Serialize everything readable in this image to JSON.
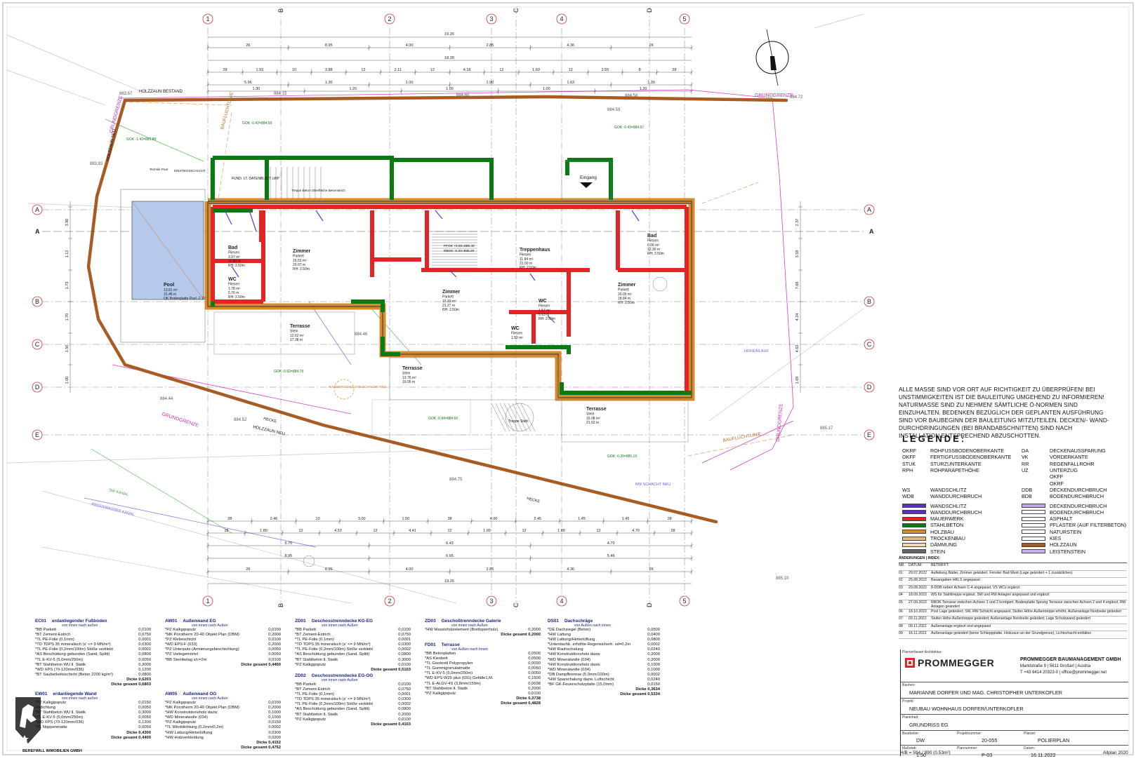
{
  "axes": {
    "numbers": [
      "1",
      "2",
      "3",
      "4",
      "5"
    ],
    "letters_top": [
      "B",
      "C",
      "D"
    ],
    "letters_side": [
      "A",
      "B",
      "C",
      "D",
      "E"
    ],
    "section": "A"
  },
  "dims": {
    "top_total": "19.26",
    "top_row1": [
      "26",
      "8.95",
      "4.00",
      "2.85",
      "4.36",
      "26"
    ],
    "top_row2": "18.30",
    "top_row3": [
      "28",
      "1.93",
      "10",
      "3.88",
      "12",
      "2.11",
      "12",
      "4.18",
      "12",
      "1.60",
      "12",
      "2.55",
      "8",
      "28"
    ],
    "top_row4": [
      "5.96",
      "1.30",
      "1.00",
      "1.90",
      "1.63",
      "1.30"
    ],
    "top_row5": [
      "1.30",
      "1.20",
      "1.00",
      "1.00",
      "1.20"
    ],
    "bottom_row1": [
      "28",
      "2.46",
      "10",
      "3.00",
      "1.50",
      "38",
      "4.00",
      "2.45",
      "1.45",
      "1.45",
      "28"
    ],
    "bottom_row2": [
      "28",
      "1.80",
      "12",
      "4.53",
      "12",
      "4.41",
      "12",
      "1.90",
      "12",
      "1.80",
      "12",
      "4.70",
      "28"
    ],
    "bottom_row3": [
      "6.75",
      "6.43",
      "4.70"
    ],
    "bottom_row4": [
      "8.95",
      "6.65",
      "5.46"
    ],
    "bottom_row5": [
      "26",
      "8.95",
      "4.00",
      "2.85",
      "4.36",
      "26"
    ],
    "bottom_total": "19.26",
    "left_col": [
      "3.90",
      "1.12",
      "1.73",
      "1.70",
      "1.50",
      "1.00"
    ],
    "right_col": [
      "2.37",
      "3.59",
      "7.68",
      "4.24",
      "4.62",
      "1.69"
    ]
  },
  "site_labels": {
    "holzzaun_bestand": "HOLZZAUN BESTAND",
    "grundgrenze": "GRUNDGRENZE",
    "baufluchtlinie": "BAUFLUCHTLINIE",
    "holzzaun_neu": "HOLZZAUN NEU",
    "hecke": "HECKE",
    "sw_kanal": "SW KANAL",
    "regenwasser_kanal": "REGENWASSER KANAL",
    "rw_schacht_neu": "RW SCHACHT NEU",
    "hoehe1": "883.67",
    "hoehe2": "884.15",
    "hoehe3": "884.60",
    "hoehe4": "884.58",
    "hoehe5": "884.72",
    "hoehe6": "884.59",
    "hoehe7": "884.44",
    "hoehe8": "884.75",
    "hoehe9": "885.17",
    "hoehe10": "885.10",
    "hoehe11": "884.52",
    "hoehe12": "883.92",
    "hoehe13": "884.46",
    "hoefeinlauf": "HOFEINLAUF",
    "wasserschacht": "WASSERSCHLEUSE SCHACHT NEU",
    "eingang": "Eingang",
    "stiege": "Treppe Stahl",
    "technik": "Technik Pool",
    "einstiegsschacht": "EINSTIEGSSCHACHT",
    "fund": "FUND. LT. DATENBLATT LWP",
    "treppe_beton": "Treppe Beton Oberfläche Besenstrich",
    "gok1": "GOK -0.42=884.58",
    "gok2": "GOK -1.42=883.88",
    "gok3": "GOK -0.43=884.97",
    "gok4": "GOK -0.82=884.78",
    "gok5": "GOK -0.84=884.66",
    "gok6": "GOK -0.20=885.10",
    "ffok_eg": "FFOK +0.00=885.40",
    "rbok_eg": "RBOK -0.20=885.20"
  },
  "rooms": [
    {
      "name": "Bad",
      "sub": "Fliesen",
      "area": "3.97 m²",
      "u": "11.80 m",
      "rh": "RH: 2.50m"
    },
    {
      "name": "WC",
      "sub": "Fliesen",
      "area": "1.78 m²",
      "u": "5.76 m",
      "rh": "RH: 2.50m"
    },
    {
      "name": "Zimmer",
      "sub": "Parkett",
      "area": "16.53 m²",
      "u": "20.07 m",
      "rh": "RH: 2.50m"
    },
    {
      "name": "Pool",
      "sub": "",
      "area": "13.81 m²",
      "u": "15.48 m",
      "rh": "OK Bodenplatte Pool -2.15"
    },
    {
      "name": "Treppenhaus",
      "sub": "Fliesen",
      "area": "11.84 m²",
      "u": "21.50 m",
      "rh": "RH: 2.50m"
    },
    {
      "name": "Zimmer",
      "sub": "Parkett",
      "area": "15.33 m²",
      "u": "21.27 m",
      "rh": "RH: 2.50m"
    },
    {
      "name": "WC",
      "sub": "Fliesen",
      "area": "1.57 m²",
      "u": "5.13 m",
      "rh": "RH: 2.50m"
    },
    {
      "name": "Bad",
      "sub": "Fliesen",
      "area": "6.06 m²",
      "u": "12.30 m",
      "rh": "RH: 2.50m"
    },
    {
      "name": "Zimmer",
      "sub": "Parkett",
      "area": "20.05 m²",
      "u": "18.84 m",
      "rh": "RH: 2.50m"
    },
    {
      "name": "Terrasse",
      "sub": "Stein",
      "area": "12.62 m²",
      "u": "17.38 m",
      "rh": ""
    },
    {
      "name": "Terrasse",
      "sub": "Stein",
      "area": "13.76 m²",
      "u": "19.05 m",
      "rh": ""
    },
    {
      "name": "Terrasse",
      "sub": "Stein",
      "area": "15.08 m²",
      "u": "21.62 m",
      "rh": ""
    },
    {
      "name": "WC",
      "sub": "Fliesen",
      "area": "1.53 m²",
      "u": "",
      "rh": ""
    }
  ],
  "notes": "ALLE MASSE SIND VOR ORT AUF RICHTIGKEIT ZU ÜBERPRÜFEN! BEI UNSTIMMIGKEITEN IST DIE BAULEITUNG UMGEHEND ZU INFORMIEREN! NATURMASSE SIND ZU NEHMEN! SÄMTLICHE Ö-NORMEN SIND EINZUHALTEN. BEDENKEN BEZÜGLICH DER GEPLANTEN AUSFÜHRUNG SIND VOR BAUBEGINN DER BAULEITUNG MITZUTEILEN. DECKEN/- WAND- DURCHDRINGUNGEN (BEI BRANDABSCHNITTEN) SIND NACH INSTALLATION ENTSPRECHEND ABZUSCHOTTEN.",
  "legend": {
    "title": "LEGENDE:",
    "left": [
      {
        "code": "OKRF",
        "label": "ROHFUSSBODENOBERKANTE"
      },
      {
        "code": "OKFF",
        "label": "FERTIGFUSSBODENOBERKANTE"
      },
      {
        "code": "STUK",
        "label": "STURZUNTERKANTE"
      },
      {
        "code": "RPH",
        "label": "ROHPARAPETHÖHE"
      },
      {
        "code": "",
        "label": ""
      },
      {
        "code": "",
        "label": ""
      },
      {
        "code": "WS",
        "label": "WANDSCHLITZ"
      },
      {
        "code": "WDB",
        "label": "WANDDURCHBRUCH"
      }
    ],
    "right": [
      {
        "code": "DA",
        "label": "DECKENAUSSPARUNG"
      },
      {
        "code": "VK",
        "label": "VORDERKANTE"
      },
      {
        "code": "RR",
        "label": "REGENFALLROHR"
      },
      {
        "code": "UZ",
        "label": "UNTERZUG"
      },
      {
        "code": "",
        "label": "OKFF"
      },
      {
        "code": "",
        "label": "OKRF"
      },
      {
        "code": "DDB",
        "label": "DECKENDURCHBRUCH"
      },
      {
        "code": "BDB",
        "label": "BODENDURCHBRUCH"
      }
    ],
    "swatches_left": [
      {
        "label": "WANDSCHLITZ",
        "color": "#5b2fbf"
      },
      {
        "label": "WANDDURCHBRUCH",
        "color": "#5b2fbf"
      },
      {
        "label": "MAUERWERK",
        "color": "#e32424"
      },
      {
        "label": "STAHLBETON",
        "color": "#0c7a12"
      },
      {
        "label": "HOLZBAU",
        "color": "#d98a2b"
      },
      {
        "label": "TROCKENBAU",
        "color": "#e8b87a"
      },
      {
        "label": "DÄMMUNG",
        "color": "#f4d8a6"
      },
      {
        "label": "STEIN",
        "color": "#666666"
      }
    ],
    "swatches_right": [
      {
        "label": "DECKENDURCHBRUCH",
        "color": "#bda6ec"
      },
      {
        "label": "BODENDURCHBRUCH",
        "color": "#ffffff"
      },
      {
        "label": "ASPHALT",
        "color": "#ffffff"
      },
      {
        "label": "PFLASTER (AUF FILTERBETON)",
        "color": "#ffffff"
      },
      {
        "label": "NATURSTEIN",
        "color": "#ffffff"
      },
      {
        "label": "KIES",
        "color": "#ffffff"
      },
      {
        "label": "HOLZZAUN",
        "color": "#a85b22"
      },
      {
        "label": "LEISTENSTEIN",
        "color": "#c8b4ef"
      }
    ]
  },
  "changes": {
    "title": "ÄNDERUNGEN | INDEX:",
    "head": [
      "NR.",
      "DATUM:",
      "BETRIFFT:"
    ],
    "rows": [
      {
        "nr": "01",
        "date": "29.07.2022",
        "text": "Aufteilung Bäder, Zimmer geändert. Fenster Bad West (Lage geändert + 1 zusätzliches)"
      },
      {
        "nr": "02",
        "date": "25.08.2022",
        "text": "Bauangaben HKLS angepasst"
      },
      {
        "nr": "03",
        "date": "29.08.2022",
        "text": "8-DDB neben Achsen C-4 angepasst, VS WCs ergänzt"
      },
      {
        "nr": "04",
        "date": "18.09.2022",
        "text": "WS für Stahltreppe ergänzt, SW und RW Anlagen angepasst und ergänzt"
      },
      {
        "nr": "05",
        "date": "27.09.2022",
        "text": "RBOK Terrasse zwischen Achsen 1 und 2 korrigiert, Bodenplatte Sprung Terrasse zwischen Achsen 2 und 4 ergänzt, RW Anlagen geändert"
      },
      {
        "nr": "06",
        "date": "18.10.2022",
        "text": "Pool Lage geändert; SW, RW Schacht angepasst, Stufen Höhe Außentreppe erhöht, Außenanlage Nordseite geändert"
      },
      {
        "nr": "07",
        "date": "03.11.2022",
        "text": "Stufen Höhe Außentreppe geändert; Außenanlage Nordseite geändert; Lage Schutzwand geändert"
      },
      {
        "nr": "08",
        "date": "09.11.2022",
        "text": "Außenanlage ergänzt und angepasst"
      },
      {
        "nr": "09",
        "date": "16.11.2022",
        "text": "Außenanlage geändert (keine Schleppplatte, Holzzaun an der Grundgrenze), Lichtschacht entfallen"
      }
    ]
  },
  "titleblock": {
    "planverfasser_label": "Planverfasser Architektur:",
    "brand": "PROMMEGGER",
    "company": "PROMMEGGER BAUMANAGEMENT GMBH",
    "address": "Marktstraße 9 | 5611 Großarl | Austria",
    "contact": "T +43 6414 20323-0 | office@prommegger.net",
    "bauherr_label": "Bauherr:",
    "bauherr": "MARIANNE DORFER UND MAG. CHRISTOPHER UNTERKOFLER",
    "projekt_label": "Projekt:",
    "projekt": "NEUBAU WOHNHAUS DORFER/UNTERKOFLER",
    "planinhalt_label": "Planinhalt:",
    "planinhalt": "GRUNDRISS EG",
    "bearbeiter_label": "Bearbeiter:",
    "bearbeiter": "DW",
    "projektnummer_label": "Projektnummer:",
    "projektnummer": "20-055",
    "planart_label": "Planart:",
    "planart": "POLIERPLAN",
    "massstab_label": "Maßstab:",
    "massstab": "1:50",
    "plannummer_label": "Plannummer:",
    "plannummer": "P-03",
    "datum_label": "Datum:",
    "datum": "16.11.2022",
    "hb": "H/B = 594 / 890 (0.53m²)",
    "software": "Allplan 2020"
  },
  "footer_left": "BEREFWILL IMMOBILIEN GMBH",
  "layers": [
    {
      "code": "EC01",
      "name": "erdanliegender Fußboden",
      "sub": "von innen nach außen",
      "rows": [
        [
          "*BB Parkett",
          "0,0100"
        ],
        [
          "*BT Zement-Estrich",
          "0,0750"
        ],
        [
          "*TL PE-Folie (0,1mm)",
          "0,0001"
        ],
        [
          "*TD TDPS 35 mineralisch (s' <= 9 MN/m³)",
          "0,0300"
        ],
        [
          "*TL PE-Folie (0,2mm/100m) Stöße verklebt",
          "0,0002"
        ],
        [
          "*AS Beschüttung gebunden (Sand, Splitt)",
          "0,0800"
        ],
        [
          "*TL E-KV-5 (5,0mm/250m)",
          "0,0050"
        ],
        [
          "*BT Stahlbeton WU ll. Statik",
          "0,3000"
        ],
        [
          "*WD XPS (70-120mm/036)",
          "0,1200"
        ],
        [
          "*BT Sauberkeitsschicht (Beton 2200 kg/m³)",
          "0,0800"
        ]
      ],
      "s1": "Dicke 0,6203",
      "s2": "Dicke gesamt 0,6803"
    },
    {
      "code": "EW01",
      "name": "erdanliegende Wand",
      "sub": "von innen nach außen",
      "rows": [
        [
          "*PZ Kalkgipsputz",
          "0,0150"
        ],
        [
          "Abdichtung",
          "0,0050"
        ],
        [
          "*BT Stahlbeton WU ll. Statik",
          "0,3000"
        ],
        [
          "*TL E-KV-5 (5,0mm/250m)",
          "0,0050"
        ],
        [
          "*WD XPS (70-120mm/036)",
          "0,1200"
        ],
        [
          "*PL Noppenmatte",
          "0,0050"
        ]
      ],
      "s1": "Dicke 0,4300",
      "s2": "Dicke gesamt 0,4400"
    },
    {
      "code": "AW01",
      "name": "Außenwand EG",
      "sub": "von innen nach Außen",
      "rows": [
        [
          "*PZ Kalkgipsputz",
          "0,0150"
        ],
        [
          "*MK Porotherm 20-40 Objekt Plan (DBM)",
          "0,2000"
        ],
        [
          "*PZ Klebeschicht",
          "0,0100"
        ],
        [
          "*WD EPS-F (033)",
          "0,2000"
        ],
        [
          "*PZ Unterputz (Armierungsbeschichtung)",
          "0,0050"
        ],
        [
          "*PZ Verlegemörtel",
          "0,0050"
        ],
        [
          "*BB Steinbelag s/c=2m",
          "0,0100"
        ]
      ],
      "s1": "Dicke gesamt 0,4450",
      "s2": ""
    },
    {
      "code": "AW05",
      "name": "Außenwand OG",
      "sub": "von innen nach Außen",
      "rows": [
        [
          "*PZ Kalkgipsputz",
          "0,0150"
        ],
        [
          "*MK Porotherm 20-40 Objekt Plan (DBM)",
          "0,2000"
        ],
        [
          "*HW Konstruktionsholz dazw.",
          "0,1000"
        ],
        [
          "*WD Mineralwolle (034)",
          "0,1000"
        ],
        [
          "*PZ Kalkgipsputz",
          "0,0150"
        ],
        [
          "*TL Winddichtung (0,2mm/0,2m)",
          "0,0002"
        ],
        [
          "*HW Lattung/Hinterlüftung",
          "0,0300"
        ],
        [
          "*HW Holzverkleidung",
          "0,0200"
        ]
      ],
      "s1": "Dicke 0,4152",
      "s2": "Dicke gesamt 0,4752"
    },
    {
      "code": "ZD01",
      "name": "Geschosstrenndecke KG-EG",
      "sub": "von innen nach Außen",
      "rows": [
        [
          "*BB Parkett",
          "0,0100"
        ],
        [
          "*BT Zement-Estrich",
          "0,0750"
        ],
        [
          "*TL PE-Folie (0,1mm)",
          "0,0001"
        ],
        [
          "*TD TDPS 35 mineralisch (s' <= 9 MN/m³)",
          "0,0300"
        ],
        [
          "*TL PE-Folie (0,2mm/100m) Stöße verklebt",
          "0,0002"
        ],
        [
          "*AS Beschüttung gebunden (Sand, Splitt)",
          "0,0800"
        ],
        [
          "*BT Stahlbeton lt. Statik",
          "0,3000"
        ],
        [
          "*PZ Kalkgipsputz",
          "0,0100"
        ]
      ],
      "s1": "Dicke gesamt 0,5103",
      "s2": ""
    },
    {
      "code": "ZD02",
      "name": "Geschosstrenndecke EG-OG",
      "sub": "von innen nach Außen",
      "rows": [
        [
          "*BB Parkett",
          "0,0100"
        ],
        [
          "*BT Zement-Estrich",
          "0,0750"
        ],
        [
          "*TL PE-Folie (0,1mm)",
          "0,0001"
        ],
        [
          "*TD TDPS 35 mineralisch (s' <= 9 MN/m³)",
          "0,0300"
        ],
        [
          "*TL PE-Folie (0,2mm/100m) Stöße verklebt",
          "0,0002"
        ],
        [
          "*AS Beschüttung gebunden (Sand, Splitt)",
          "0,0800"
        ],
        [
          "*BT Stahlbeton lt. Statik",
          "0,2000"
        ],
        [
          "*PZ Kalkgipsputz",
          "0,0100"
        ]
      ],
      "s1": "Dicke gesamt 0,4103",
      "s2": ""
    },
    {
      "code": "ZD03",
      "name": "Geschoßtrenndecke Galerie",
      "sub": "von innen nach Außen",
      "rows": [
        [
          "*HW Massivholzelement (Brettsperrholz)",
          "0,2000"
        ]
      ],
      "s1": "Dicke gesamt 0,2000",
      "s2": ""
    },
    {
      "code": "FD01",
      "name": "Terrasse",
      "sub": "von Außen nach Innen",
      "rows": [
        [
          "*BB Betonplatten",
          "0,0500"
        ],
        [
          "*AS Kiesbett",
          "0,0500"
        ],
        [
          "*TL Geotextil Polypropylen",
          "0,0030"
        ],
        [
          "*TL Gummigranulatmatte",
          "0,0050"
        ],
        [
          "*TL E-KV-5 (5,0mm/250m)",
          "0,0050"
        ],
        [
          "*WD EPS-W25 plus (031) Gefälle1,M.",
          "0,1500"
        ],
        [
          "*TL E-ALGV-4S (3,8mm/150m)",
          "0,0038"
        ],
        [
          "*BT Stahlbeton lt. Statik",
          "0,2000"
        ],
        [
          "*PZ Kalkgipsputz",
          "0,0100"
        ]
      ],
      "s1": "Dicke 0,3738",
      "s2": "Dicke gesamt 0,4828"
    },
    {
      "code": "DS01",
      "name": "Dachschräge",
      "sub": "von Außen nach Innen",
      "rows": [
        [
          "*DE Dachziegel (Beton)",
          "0,0500"
        ],
        [
          "*HW Lattung",
          "0,0400"
        ],
        [
          "*HW Lattung/Hinterlüftung",
          "0,0800"
        ],
        [
          "*Unterdachb. erhöhte Regensicherh. sd=0,2m",
          "0,0002"
        ],
        [
          "*HW Rauhschalung",
          "0,0240"
        ],
        [
          "*HW Konstruktionsholz dazw.",
          "0,2000"
        ],
        [
          "*WD Mineralwolle (034)",
          "0,2000"
        ],
        [
          "*HW Konstruktionsholz dazw.",
          "0,1000"
        ],
        [
          "*WD Mineralwolle (034)",
          "0,1000"
        ],
        [
          "*DB Dampfbremse (5,0mm/100m)",
          "0,0002"
        ],
        [
          "*HW Sparschalung dazw. Luftschicht",
          "0,0240"
        ],
        [
          "*BF GK-Feuerschutzplatte (15,0mm)",
          "0,0150"
        ]
      ],
      "s1": "Dicke 0,3634",
      "s2": "Dicke gesamt 0,5334"
    }
  ]
}
